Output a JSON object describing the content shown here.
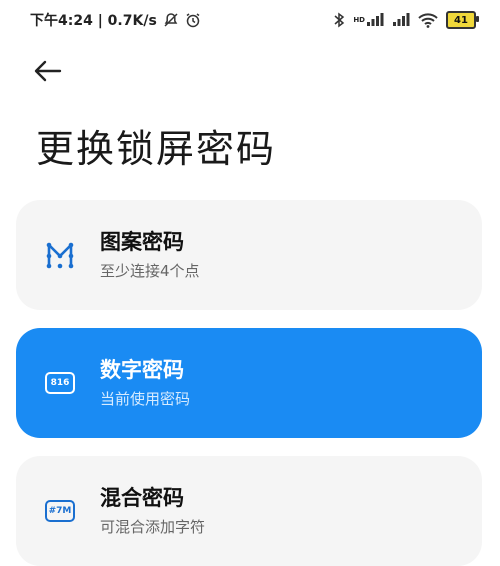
{
  "status_bar": {
    "time_speed": "下午4:24 | 0.7K/s",
    "network_label": "HD",
    "battery": "41"
  },
  "header": {
    "title": "更换锁屏密码"
  },
  "options": [
    {
      "title": "图案密码",
      "subtitle": "至少连接4个点",
      "icon": "pattern-icon",
      "selected": false
    },
    {
      "title": "数字密码",
      "subtitle": "当前使用密码",
      "icon_text": "816",
      "icon": "numeric-icon",
      "selected": true
    },
    {
      "title": "混合密码",
      "subtitle": "可混合添加字符",
      "icon_text": "#7M",
      "icon": "mixed-icon",
      "selected": false
    }
  ],
  "colors": {
    "accent": "#1a8bf3",
    "card_bg": "#f5f5f5"
  }
}
